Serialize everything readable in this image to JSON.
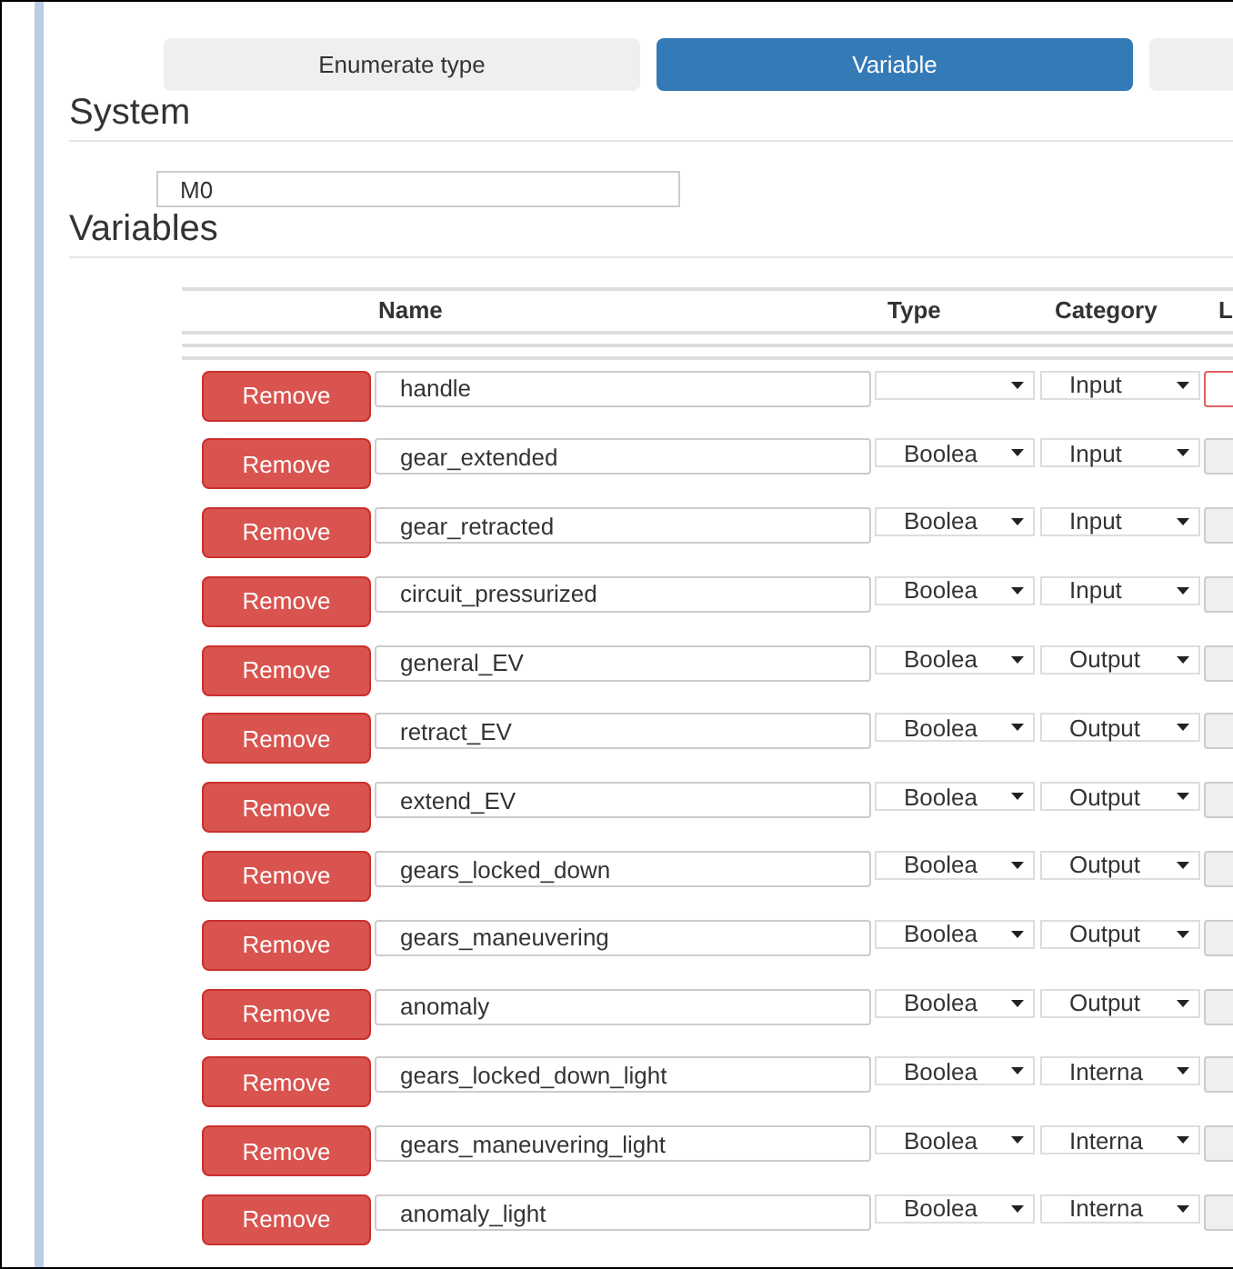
{
  "tabs": [
    {
      "label": "Enumerate type",
      "selected": false
    },
    {
      "label": "Variable",
      "selected": true
    },
    {
      "selected": false
    }
  ],
  "system": {
    "heading": "System",
    "value": "M0"
  },
  "variables": {
    "heading": "Variables",
    "columns": [
      "Name",
      "Type",
      "Category",
      "L"
    ],
    "rows": [
      {
        "action": "Remove",
        "name": "handle",
        "category": "Input",
        "invalid": true
      },
      {
        "action": "Remove",
        "name": "gear_extended",
        "type": "Boolea",
        "category": "Input",
        "invalid": false
      },
      {
        "action": "Remove",
        "name": "gear_retracted",
        "type": "Boolea",
        "category": "Input",
        "invalid": false
      },
      {
        "action": "Remove",
        "name": "circuit_pressurized",
        "type": "Boolea",
        "category": "Input",
        "invalid": false
      },
      {
        "action": "Remove",
        "name": "general_EV",
        "type": "Boolea",
        "category": "Output",
        "invalid": false
      },
      {
        "action": "Remove",
        "name": "retract_EV",
        "type": "Boolea",
        "category": "Output",
        "invalid": false
      },
      {
        "action": "Remove",
        "name": "extend_EV",
        "type": "Boolea",
        "category": "Output",
        "invalid": false
      },
      {
        "action": "Remove",
        "name": "gears_locked_down",
        "type": "Boolea",
        "category": "Output",
        "invalid": false
      },
      {
        "action": "Remove",
        "name": "gears_maneuvering",
        "type": "Boolea",
        "category": "Output",
        "invalid": false
      },
      {
        "action": "Remove",
        "name": "anomaly",
        "type": "Boolea",
        "category": "Output",
        "invalid": false
      },
      {
        "action": "Remove",
        "name": "gears_locked_down_light",
        "type": "Boolea",
        "category": "Interna",
        "invalid": false
      },
      {
        "action": "Remove",
        "name": "gears_maneuvering_light",
        "type": "Boolea",
        "category": "Interna",
        "invalid": false
      },
      {
        "action": "Remove",
        "name": "anomaly_light",
        "type": "Boolea",
        "category": "Interna",
        "invalid": false
      }
    ]
  }
}
